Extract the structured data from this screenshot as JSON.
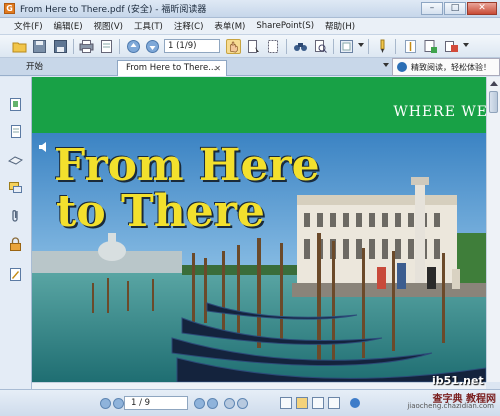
{
  "window": {
    "title": "From Here to There.pdf (安全) - 福昕阅读器",
    "app_icon_letter": "G",
    "minimize": "–",
    "maximize": "□",
    "close": "✕"
  },
  "menubar": {
    "items": [
      {
        "label": "文件(F)"
      },
      {
        "label": "编辑(E)"
      },
      {
        "label": "视图(V)"
      },
      {
        "label": "工具(T)"
      },
      {
        "label": "注释(C)"
      },
      {
        "label": "表单(M)"
      },
      {
        "label": "SharePoint(S)"
      },
      {
        "label": "帮助(H)"
      }
    ]
  },
  "toolbar": {
    "page_value": "1 (1/9)"
  },
  "tabs": {
    "home_label": "开始",
    "doc_label": "From Here to There...",
    "doc_close": "✕"
  },
  "promo": {
    "text": "精致阅读，轻松体验！"
  },
  "document": {
    "banner_text": "WHERE WE",
    "cover_line1": "From Here",
    "cover_line2": "to There"
  },
  "statusbar": {
    "page_value": "1 / 9",
    "watermark_site": "查字典 教程网",
    "watermark_url": "jiaocheng.chazidian.com"
  },
  "overlay": {
    "ib51": "ib51.net"
  },
  "colors": {
    "banner_green": "#18a146",
    "title_yellow": "#f3e02d"
  }
}
